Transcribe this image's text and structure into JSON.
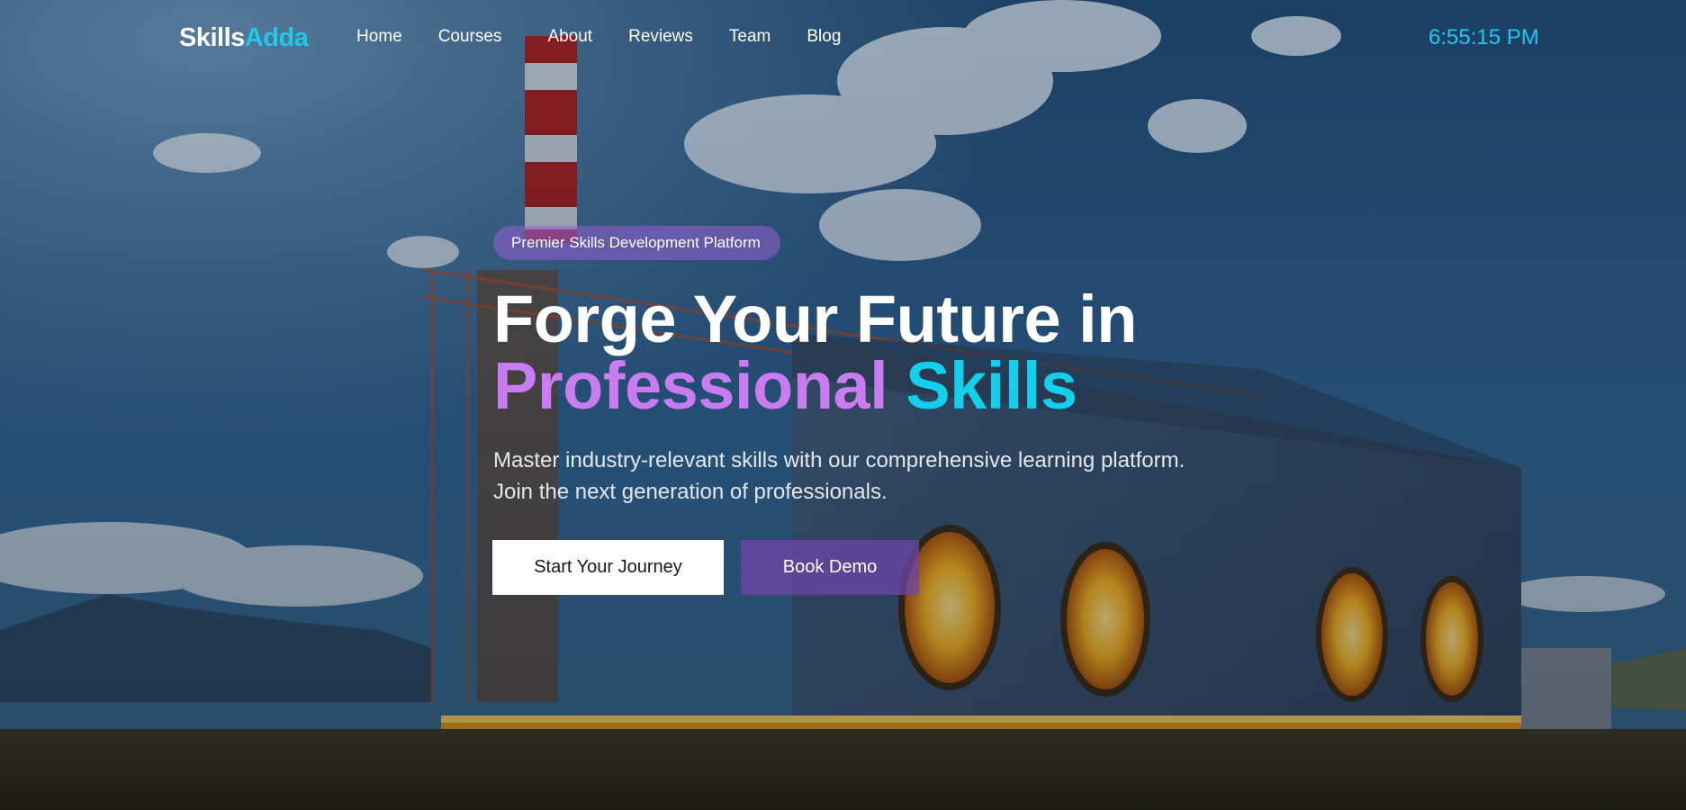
{
  "brand": {
    "name_part1": "Skills",
    "name_part2": "Adda",
    "accent_color": "#1ec8ef"
  },
  "nav": {
    "links": [
      {
        "label": "Home"
      },
      {
        "label": "Courses"
      },
      {
        "label": "About"
      },
      {
        "label": "Reviews"
      },
      {
        "label": "Team"
      },
      {
        "label": "Blog"
      }
    ]
  },
  "clock": {
    "time": "6:55:15 PM"
  },
  "hero": {
    "badge": "Premier Skills Development Platform",
    "title_line1": "Forge Your Future in",
    "title_word_purple": "Professional",
    "title_word_cyan": "Skills",
    "subtitle_line1": "Master industry-relevant skills with our comprehensive learning platform.",
    "subtitle_line2": "Join the next generation of professionals.",
    "primary_button": "Start Your Journey",
    "secondary_button": "Book Demo"
  },
  "colors": {
    "purple_text": "#c87cf0",
    "cyan_text": "#14cfec",
    "badge_bg": "#965fd2",
    "secondary_button_bg": "#6e46aa"
  }
}
